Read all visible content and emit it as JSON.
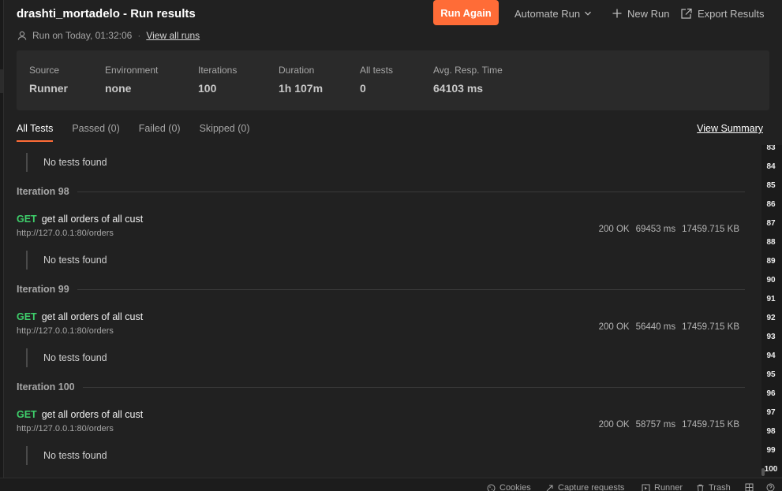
{
  "header": {
    "title": "drashti_mortadelo - Run results",
    "run_on": "Run on Today, 01:32:06",
    "separator": "·",
    "view_all_runs": "View all runs",
    "run_again": "Run Again",
    "automate_run": "Automate Run",
    "new_run": "New Run",
    "export_results": "Export Results"
  },
  "summary": {
    "source": {
      "label": "Source",
      "value": "Runner"
    },
    "environment": {
      "label": "Environment",
      "value": "none"
    },
    "iterations": {
      "label": "Iterations",
      "value": "100"
    },
    "duration": {
      "label": "Duration",
      "value": "1h 107m"
    },
    "all_tests": {
      "label": "All tests",
      "value": "0"
    },
    "avg_resp": {
      "label": "Avg. Resp. Time",
      "value": "64103 ms"
    }
  },
  "tabs": [
    {
      "label": "All Tests"
    },
    {
      "label": "Passed (0)"
    },
    {
      "label": "Failed (0)"
    },
    {
      "label": "Skipped (0)"
    }
  ],
  "view_summary": "View Summary",
  "results": {
    "no_tests_text": "No tests found",
    "iterations": [
      {
        "title": "Iteration 98",
        "method": "GET",
        "name": "get all orders of all cust",
        "url": "http://127.0.0.1:80/orders",
        "status": "200 OK",
        "time": "69453 ms",
        "size": "17459.715 KB"
      },
      {
        "title": "Iteration 99",
        "method": "GET",
        "name": "get all orders of all cust",
        "url": "http://127.0.0.1:80/orders",
        "status": "200 OK",
        "time": "56440 ms",
        "size": "17459.715 KB"
      },
      {
        "title": "Iteration 100",
        "method": "GET",
        "name": "get all orders of all cust",
        "url": "http://127.0.0.1:80/orders",
        "status": "200 OK",
        "time": "58757 ms",
        "size": "17459.715 KB"
      }
    ]
  },
  "minimap": [
    "83",
    "84",
    "85",
    "86",
    "87",
    "88",
    "89",
    "90",
    "91",
    "92",
    "93",
    "94",
    "95",
    "96",
    "97",
    "98",
    "99",
    "100"
  ],
  "statusbar": {
    "cookies": "Cookies",
    "capture": "Capture requests",
    "runner": "Runner",
    "trash": "Trash"
  },
  "colors": {
    "accent": "#ff6c37",
    "method_get": "#3ecf6b",
    "background": "#212121",
    "panel": "#2a2a2a"
  }
}
